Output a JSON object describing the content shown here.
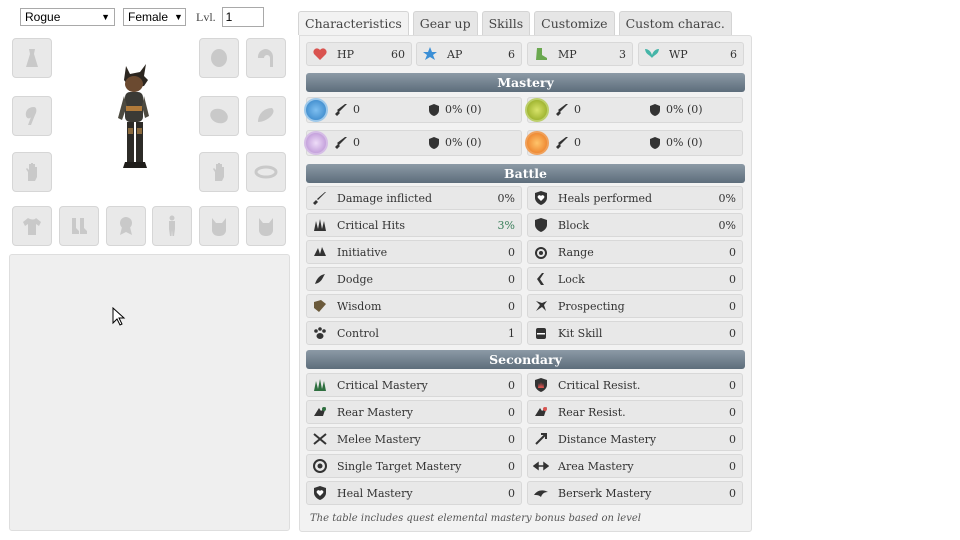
{
  "character": {
    "class_value": "Rogue",
    "gender_value": "Female",
    "level_label": "Lvl.",
    "level_value": "1"
  },
  "tabs": [
    {
      "label": "Characteristics",
      "active": true
    },
    {
      "label": "Gear up"
    },
    {
      "label": "Skills"
    },
    {
      "label": "Customize"
    },
    {
      "label": "Custom charac."
    }
  ],
  "base_stats": [
    {
      "label": "HP",
      "value": "60",
      "icon": "heart-icon",
      "color": "#d9534f"
    },
    {
      "label": "AP",
      "value": "6",
      "icon": "star-icon",
      "color": "#3b8fd6"
    },
    {
      "label": "MP",
      "value": "3",
      "icon": "boot-icon",
      "color": "#6aa84f"
    },
    {
      "label": "WP",
      "value": "6",
      "icon": "wings-icon",
      "color": "#45b5a8"
    }
  ],
  "mastery": {
    "title": "Mastery",
    "elements": [
      {
        "name": "water",
        "attack": "0",
        "resist": "0% (0)",
        "color": "#3b8fd6"
      },
      {
        "name": "earth",
        "attack": "0",
        "resist": "0% (0)",
        "color": "#8aa31b"
      },
      {
        "name": "air",
        "attack": "0",
        "resist": "0% (0)",
        "color": "#b48ad1"
      },
      {
        "name": "fire",
        "attack": "0",
        "resist": "0% (0)",
        "color": "#e8731e"
      }
    ]
  },
  "battle": {
    "title": "Battle",
    "rows": [
      {
        "label": "Damage inflicted",
        "value": "0%"
      },
      {
        "label": "Heals performed",
        "value": "0%"
      },
      {
        "label": "Critical Hits",
        "value": "3%"
      },
      {
        "label": "Block",
        "value": "0%"
      },
      {
        "label": "Initiative",
        "value": "0"
      },
      {
        "label": "Range",
        "value": "0"
      },
      {
        "label": "Dodge",
        "value": "0"
      },
      {
        "label": "Lock",
        "value": "0"
      },
      {
        "label": "Wisdom",
        "value": "0"
      },
      {
        "label": "Prospecting",
        "value": "0"
      },
      {
        "label": "Control",
        "value": "1"
      },
      {
        "label": "Kit Skill",
        "value": "0"
      }
    ]
  },
  "secondary": {
    "title": "Secondary",
    "rows": [
      {
        "label": "Critical Mastery",
        "value": "0"
      },
      {
        "label": "Critical Resist.",
        "value": "0"
      },
      {
        "label": "Rear Mastery",
        "value": "0"
      },
      {
        "label": "Rear Resist.",
        "value": "0"
      },
      {
        "label": "Melee Mastery",
        "value": "0"
      },
      {
        "label": "Distance Mastery",
        "value": "0"
      },
      {
        "label": "Single Target Mastery",
        "value": "0"
      },
      {
        "label": "Area Mastery",
        "value": "0"
      },
      {
        "label": "Heal Mastery",
        "value": "0"
      },
      {
        "label": "Berserk Mastery",
        "value": "0"
      }
    ]
  },
  "footnote": "The table includes quest elemental mastery bonus based on level",
  "equipment_slots": [
    "amulet-slot-icon",
    "helmet-slot-icon",
    "cape-slot-icon",
    "ring-left-slot-icon",
    "shoulders-slot-icon",
    "breastplate-slot-icon",
    "glove-left-slot-icon",
    "glove-right-slot-icon",
    "belt-slot-icon",
    "shirt-slot-icon",
    "boots-slot-icon",
    "emblem-slot-icon",
    "costume-slot-icon",
    "pet-slot-icon",
    "mount-slot-icon"
  ]
}
